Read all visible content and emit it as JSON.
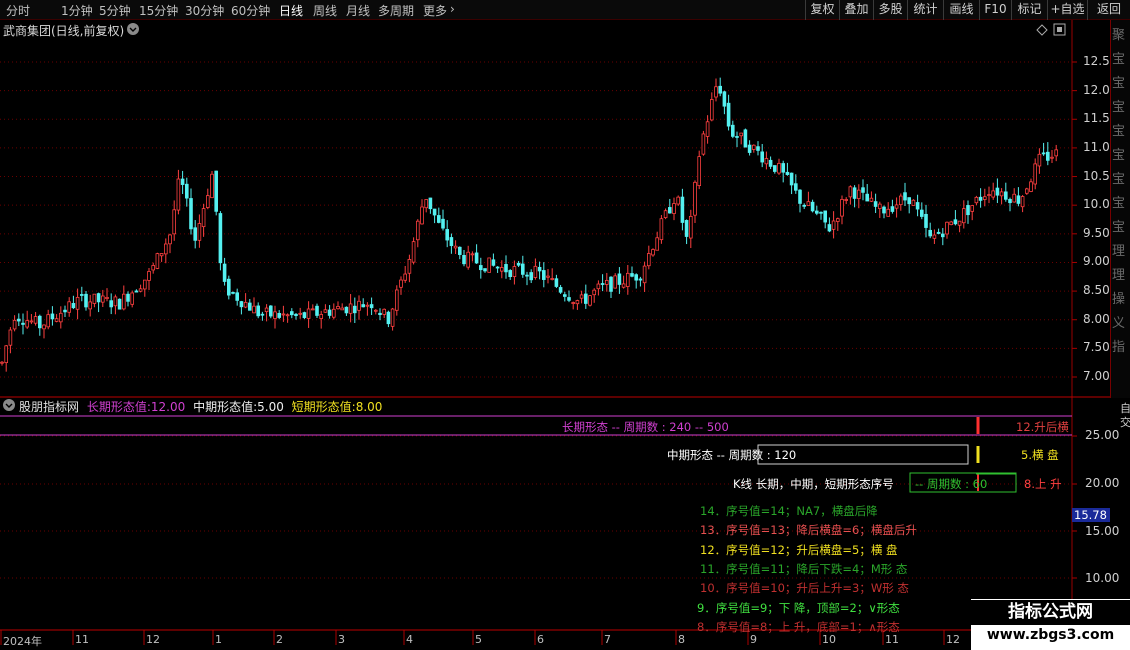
{
  "toolbar": {
    "periods": [
      "分时",
      "1分钟",
      "5分钟",
      "15分钟",
      "30分钟",
      "60分钟",
      "日线",
      "周线",
      "月线",
      "多周期",
      "更多"
    ],
    "active_period": "日线",
    "tools": [
      "复权",
      "叠加",
      "多股",
      "统计",
      "画线",
      "F10",
      "标记",
      "+自选",
      "返回"
    ]
  },
  "chart": {
    "title": "武商集团(日线,前复权)",
    "price_axis": [
      "12.50",
      "12.00",
      "11.50",
      "11.00",
      "10.50",
      "10.00",
      "9.50",
      "9.00",
      "8.50",
      "8.00",
      "7.50",
      "7.00"
    ]
  },
  "indicator": {
    "name": "股朋指标网",
    "long_label": "长期形态值:",
    "long_value": "12.00",
    "mid_label": "中期形态值:",
    "mid_value": "5.00",
    "short_label": "短期形态值:",
    "short_value": "8.00",
    "axis": [
      "25.00",
      "20.00",
      "15.00",
      "10.00"
    ],
    "current_value": "15.78",
    "long_banner": "长期形态 -- 周期数 : 240 -- 500",
    "long_state": "12.升后横",
    "mid_banner": "中期形态 -- 周期数 : 120",
    "mid_state": "5.横 盘",
    "short_banner": "K线 长期，中期，短期形态序号",
    "short_period": "-- 周期数 : 60",
    "short_state": "8.上 升",
    "left_col": [
      {
        "text": "14．序号值=14；NA7，横盘后降",
        "color": "#2aa62a"
      },
      {
        "text": "13．序号值=13；降后横盘=6；横盘后升",
        "color": "#e85050"
      },
      {
        "text": "12．序号值=12；升后横盘=5；横 盘",
        "color": "#f0e020"
      },
      {
        "text": "11．序号值=11；降后下跌=4；M形 态",
        "color": "#2aa62a"
      },
      {
        "text": "10．序号值=10；升后上升=3；W形 态",
        "color": "#c03030"
      },
      {
        "text": "9．序号值=9；下 降，顶部=2；∨形态",
        "color": "#40e040"
      },
      {
        "text": "8．序号值=8；上 升，底部=1；∧形态",
        "color": "#c03030"
      }
    ]
  },
  "date_axis": [
    "2024年",
    "11",
    "12",
    "1",
    "2",
    "3",
    "4",
    "5",
    "6",
    "7",
    "8",
    "9",
    "10",
    "11",
    "12"
  ],
  "right_strip": [
    "聚",
    "宝",
    "宝",
    "宝",
    "宝",
    "宝",
    "宝",
    "宝",
    "宝",
    "理",
    "理",
    "操",
    "义",
    "指"
  ],
  "right_strip_lower": [
    "自",
    "交"
  ],
  "watermark": {
    "title": "指标公式网",
    "url": "www.zbgs3.com"
  },
  "colors": {
    "up": "#ff4040",
    "down": "#54f0f0",
    "grid": "#800000",
    "magenta": "#d040d0"
  }
}
